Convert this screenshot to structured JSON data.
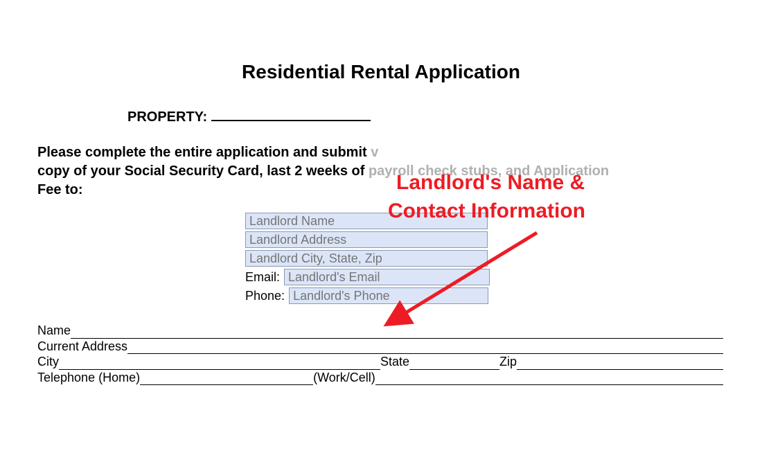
{
  "title": "Residential Rental Application",
  "property_label": "PROPERTY:",
  "instructions": {
    "line1_visible": "Please complete the entire application and submit ",
    "line1_faded_piece": "v",
    "line2_visible": "copy of your Social Security Card, last 2 weeks of ",
    "line2_faded": "payroll check stubs, and Application",
    "line3": "Fee to:"
  },
  "landlord": {
    "name_placeholder": "Landlord Name",
    "address_placeholder": "Landlord Address",
    "citystatezip_placeholder": "Landlord City, State, Zip",
    "email_label": "Email:",
    "email_placeholder": "Landlord's Email",
    "phone_label": "Phone:",
    "phone_placeholder": "Landlord's Phone"
  },
  "applicant": {
    "name_label": "Name",
    "address_label": "Current Address",
    "city_label": "City",
    "state_label": "State",
    "zip_label": "Zip",
    "telephone_home_label": "Telephone (Home)",
    "work_cell_label": "(Work/Cell)"
  },
  "annotation": {
    "line1": "Landlord's Name &",
    "line2": "Contact Information",
    "color": "#ed1c24"
  }
}
